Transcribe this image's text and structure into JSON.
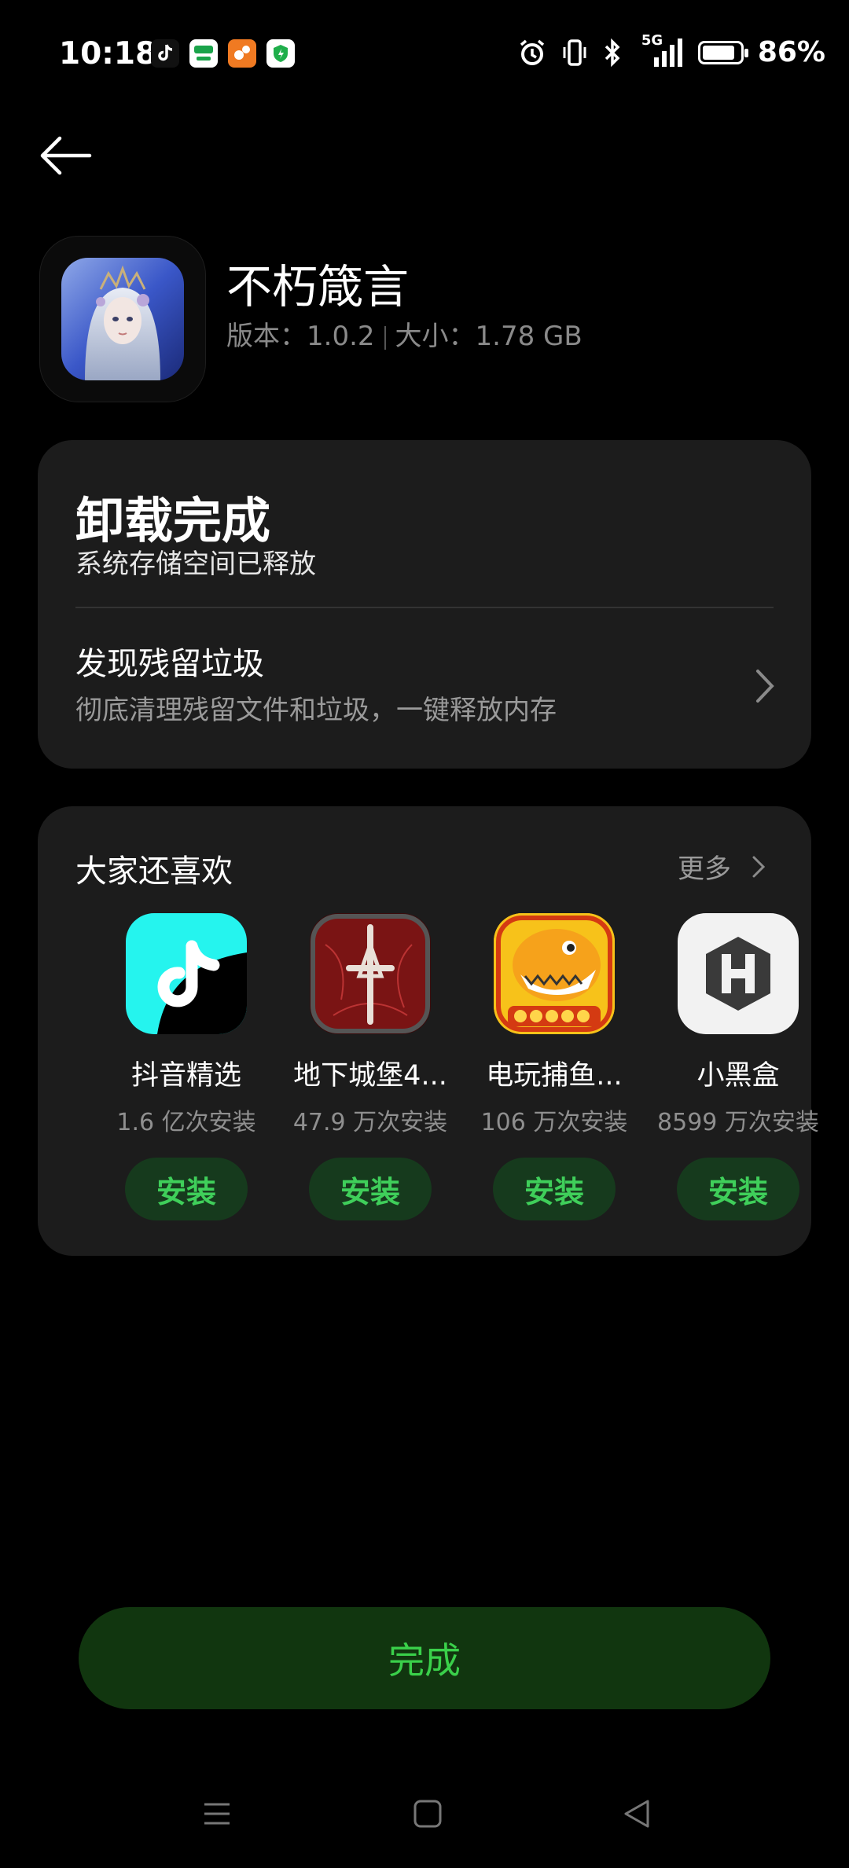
{
  "status_bar": {
    "time": "10:18",
    "notification_icons": [
      "tiktok-icon",
      "oppo-icon",
      "game-icon",
      "shield-icon"
    ],
    "system_icons": [
      "alarm-icon",
      "vibrate-icon",
      "bluetooth-icon",
      "signal-5g-icon"
    ],
    "network_label": "5G",
    "battery_percent": "86%",
    "battery_level": 0.86
  },
  "app": {
    "name": "不朽箴言",
    "version_label": "版本：1.0.2",
    "size_label": "大小：1.78 GB"
  },
  "uninstall_card": {
    "title": "卸载完成",
    "subtitle": "系统存储空间已释放",
    "junk_title": "发现残留垃圾",
    "junk_subtitle": "彻底清理残留文件和垃圾，一键释放内存"
  },
  "recommend_card": {
    "title": "大家还喜欢",
    "more_label": "更多",
    "apps": [
      {
        "name": "抖音精选",
        "installs": "1.6 亿次安装",
        "install_label": "安装",
        "icon": "douyin-icon"
      },
      {
        "name": "地下城堡4...",
        "installs": "47.9 万次安装",
        "install_label": "安装",
        "icon": "dungeon-castle-icon"
      },
      {
        "name": "电玩捕鱼...",
        "installs": "106 万次安装",
        "install_label": "安装",
        "icon": "fishing-game-icon"
      },
      {
        "name": "小黑盒",
        "installs": "8599 万次安装",
        "install_label": "安装",
        "icon": "xiaoheihe-icon"
      }
    ]
  },
  "finish_button": {
    "label": "完成"
  },
  "colors": {
    "background": "#000000",
    "card": "#1c1c1c",
    "accent_green": "#3fcf5a",
    "button_green_bg": "#163a1d"
  }
}
